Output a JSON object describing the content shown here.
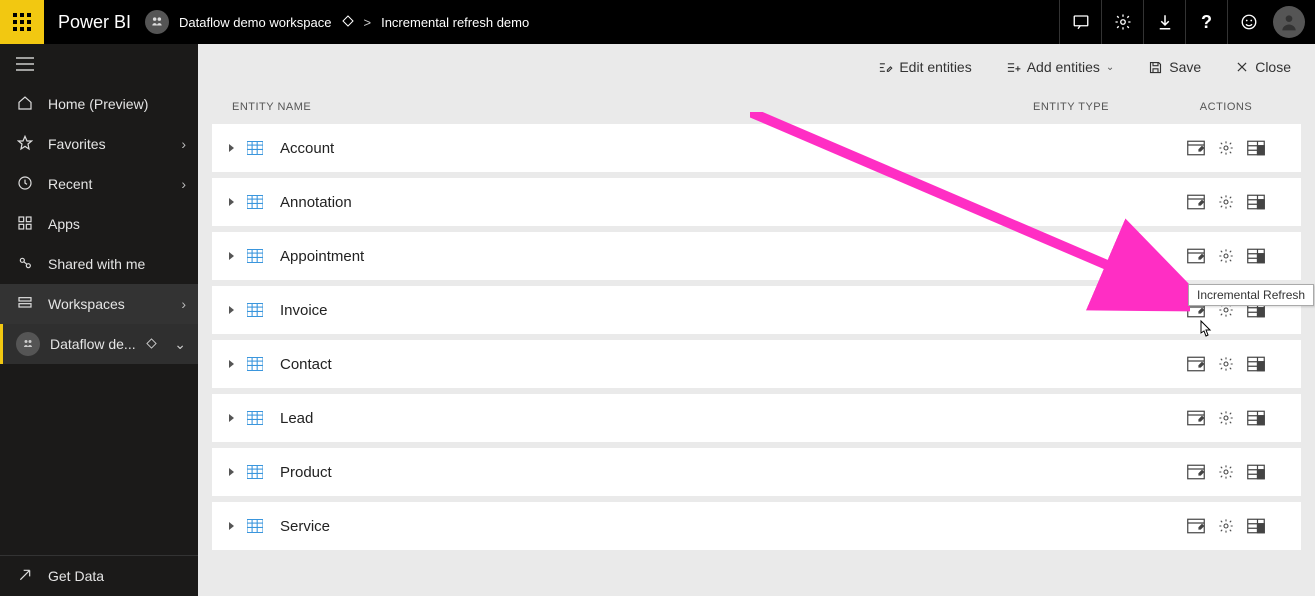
{
  "brand": "Power BI",
  "breadcrumb": {
    "workspace": "Dataflow demo workspace",
    "item": "Incremental refresh demo"
  },
  "sidebar": {
    "items": [
      {
        "label": "Home (Preview)",
        "name": "sidebar-item-home"
      },
      {
        "label": "Favorites",
        "name": "sidebar-item-favorites",
        "chev": true
      },
      {
        "label": "Recent",
        "name": "sidebar-item-recent",
        "chev": true
      },
      {
        "label": "Apps",
        "name": "sidebar-item-apps"
      },
      {
        "label": "Shared with me",
        "name": "sidebar-item-shared"
      },
      {
        "label": "Workspaces",
        "name": "sidebar-item-workspaces",
        "chev": true,
        "active": true
      }
    ],
    "workspace_sub": "Dataflow de...",
    "bottom": "Get Data"
  },
  "toolbar": {
    "edit": "Edit entities",
    "add": "Add entities",
    "save": "Save",
    "close": "Close"
  },
  "columns": {
    "name": "Entity Name",
    "type": "Entity Type",
    "actions": "Actions"
  },
  "entities": [
    {
      "name": "Account"
    },
    {
      "name": "Annotation"
    },
    {
      "name": "Appointment"
    },
    {
      "name": "Invoice"
    },
    {
      "name": "Contact"
    },
    {
      "name": "Lead"
    },
    {
      "name": "Product"
    },
    {
      "name": "Service"
    }
  ],
  "tooltip": "Incremental Refresh"
}
